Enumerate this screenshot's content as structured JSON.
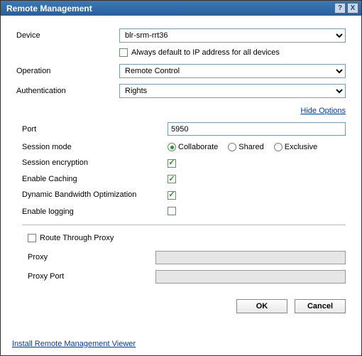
{
  "titlebar": {
    "title": "Remote Management",
    "help_glyph": "?",
    "close_glyph": "X"
  },
  "device": {
    "label": "Device",
    "value": "blr-srm-rrt36"
  },
  "always_default": {
    "label": "Always default to IP address for all devices",
    "checked": false
  },
  "operation": {
    "label": "Operation",
    "value": "Remote Control"
  },
  "authentication": {
    "label": "Authentication",
    "value": "Rights"
  },
  "hide_options_link": "Hide Options",
  "port": {
    "label": "Port",
    "value": "5950"
  },
  "session_mode": {
    "label": "Session mode",
    "options": [
      {
        "label": "Collaborate",
        "checked": true
      },
      {
        "label": "Shared",
        "checked": false
      },
      {
        "label": "Exclusive",
        "checked": false
      }
    ]
  },
  "session_encryption": {
    "label": "Session encryption",
    "checked": true
  },
  "enable_caching": {
    "label": "Enable Caching",
    "checked": true
  },
  "dyn_bw": {
    "label": "Dynamic Bandwidth Optimization",
    "checked": true
  },
  "enable_logging": {
    "label": "Enable logging",
    "checked": false
  },
  "route_proxy": {
    "label": "Route Through Proxy",
    "checked": false
  },
  "proxy": {
    "label": "Proxy",
    "value": ""
  },
  "proxy_port": {
    "label": "Proxy Port",
    "value": ""
  },
  "buttons": {
    "ok": "OK",
    "cancel": "Cancel"
  },
  "install_link": "Install Remote Management Viewer"
}
